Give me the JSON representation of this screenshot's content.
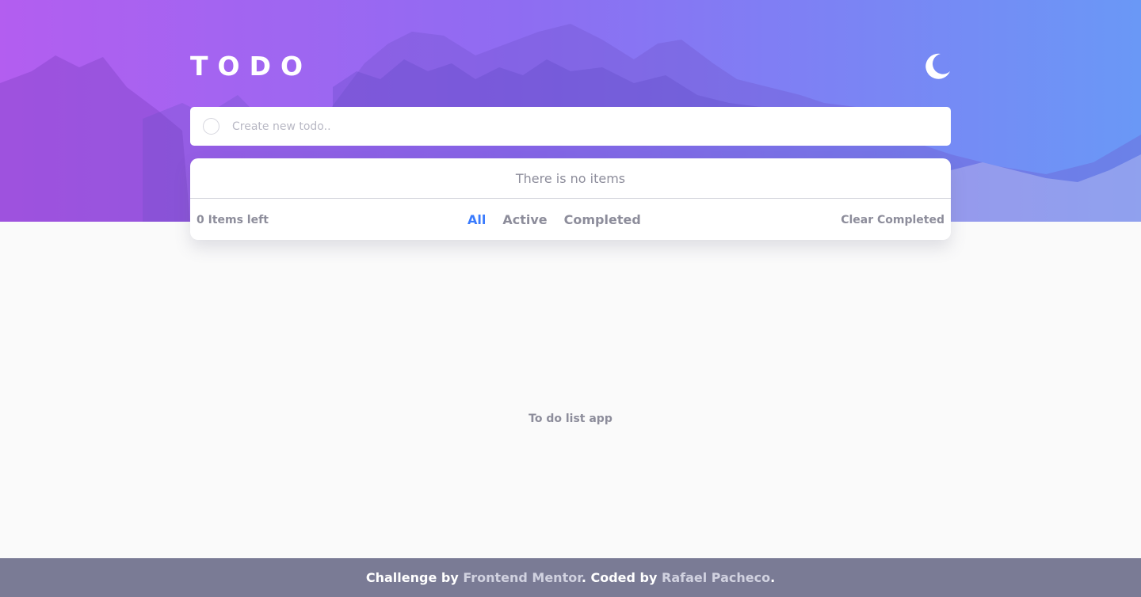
{
  "header": {
    "title": "TODO",
    "theme_icon": "moon-icon"
  },
  "new_todo": {
    "placeholder": "Create new todo..",
    "value": ""
  },
  "list": {
    "empty_message": "There is no items"
  },
  "list_footer": {
    "items_left": "0 Items left",
    "filters": [
      {
        "label": "All",
        "active": true
      },
      {
        "label": "Active",
        "active": false
      },
      {
        "label": "Completed",
        "active": false
      }
    ],
    "clear_label": "Clear Completed"
  },
  "app_note": "To do list app",
  "attribution": {
    "prefix": "Challenge by ",
    "challenge_link": "Frontend Mentor",
    "middle": ". Coded by ",
    "author_link": "Rafael Pacheco",
    "suffix": "."
  },
  "colors": {
    "accent": "#3a7bfd",
    "gradient_start": "#b35ef0",
    "gradient_end": "#6a98f6",
    "muted_text": "#8d8d9b",
    "footer_bg": "#7a7b95"
  }
}
